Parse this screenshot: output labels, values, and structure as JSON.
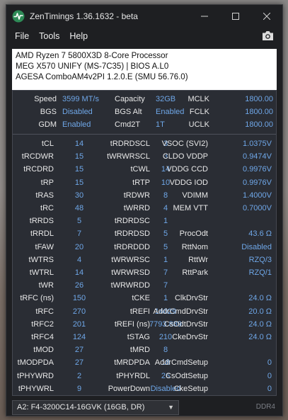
{
  "window": {
    "title": "ZenTimings 1.36.1632 - beta"
  },
  "menu": {
    "file": "File",
    "tools": "Tools",
    "help": "Help"
  },
  "sysinfo": {
    "cpu": "AMD Ryzen 7 5800X3D 8-Core Processor",
    "board": "MEG X570 UNIFY (MS-7C35) | BIOS A.L0",
    "agesa": "AGESA ComboAM4v2PI 1.2.0.E (SMU 56.76.0)"
  },
  "top": [
    [
      "Speed",
      "3599 MT/s",
      "Capacity",
      "32GB",
      "MCLK",
      "1800.00"
    ],
    [
      "BGS",
      "Disabled",
      "BGS Alt",
      "Enabled",
      "FCLK",
      "1800.00"
    ],
    [
      "GDM",
      "Enabled",
      "Cmd2T",
      "1T",
      "UCLK",
      "1800.00"
    ]
  ],
  "timings": [
    [
      "tCL",
      "14",
      "tRDRDSCL",
      "3",
      "VSOC (SVI2)",
      "1.0375V"
    ],
    [
      "tRCDWR",
      "15",
      "tWRWRSCL",
      "3",
      "CLDO VDDP",
      "0.9474V"
    ],
    [
      "tRCDRD",
      "15",
      "tCWL",
      "14",
      "VDDG CCD",
      "0.9976V"
    ],
    [
      "tRP",
      "15",
      "tRTP",
      "10",
      "VDDG IOD",
      "0.9976V"
    ],
    [
      "tRAS",
      "30",
      "tRDWR",
      "8",
      "VDIMM",
      "1.4000V"
    ],
    [
      "tRC",
      "48",
      "tWRRD",
      "4",
      "MEM VTT",
      "0.7000V"
    ],
    [
      "tRRDS",
      "5",
      "tRDRDSC",
      "1",
      "",
      ""
    ],
    [
      "tRRDL",
      "7",
      "tRDRDSD",
      "5",
      "ProcOdt",
      "43.6 Ω"
    ],
    [
      "tFAW",
      "20",
      "tRDRDDD",
      "5",
      "RttNom",
      "Disabled"
    ],
    [
      "tWTRS",
      "4",
      "tWRWRSC",
      "1",
      "RttWr",
      "RZQ/3"
    ],
    [
      "tWTRL",
      "14",
      "tWRWRSD",
      "7",
      "RttPark",
      "RZQ/1"
    ],
    [
      "tWR",
      "26",
      "tWRWRDD",
      "7",
      "",
      ""
    ],
    [
      "tRFC (ns)",
      "150",
      "tCKE",
      "1",
      "ClkDrvStr",
      "24.0 Ω"
    ],
    [
      "tRFC",
      "270",
      "tREFI",
      "14029",
      "AddrCmdDrvStr",
      "20.0 Ω"
    ],
    [
      "tRFC2",
      "201",
      "tREFI (ns)",
      "7793.889",
      "CsOdtDrvStr",
      "24.0 Ω"
    ],
    [
      "tRFC4",
      "124",
      "tSTAG",
      "210",
      "CkeDrvStr",
      "24.0 Ω"
    ],
    [
      "tMOD",
      "27",
      "tMRD",
      "8",
      "",
      ""
    ],
    [
      "tMODPDA",
      "27",
      "tMRDPDA",
      "18",
      "AddrCmdSetup",
      "0"
    ],
    [
      "tPHYWRD",
      "2",
      "tPHYRDL",
      "26",
      "CsOdtSetup",
      "0"
    ],
    [
      "tPHYWRL",
      "9",
      "PowerDown",
      "Disabled",
      "CkeSetup",
      "0"
    ]
  ],
  "dimm": {
    "selected": "A2: F4-3200C14-16GVK (16GB, DR)"
  },
  "memtype": "DDR4",
  "icons": {
    "app": "zentimings-logo-icon",
    "camera": "camera-icon"
  },
  "colors": {
    "value": "#6fa7e8",
    "label": "#e8e8e8",
    "panel": "#2a2d34",
    "window": "#1e1f22"
  }
}
